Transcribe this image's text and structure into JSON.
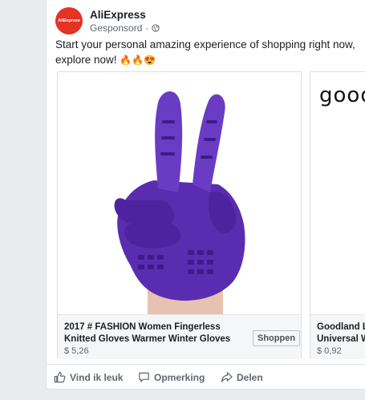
{
  "post": {
    "page_name": "AliExpress",
    "avatar_text": "AliExpress",
    "sponsored_label": "Gesponsord",
    "separator": "·",
    "caption_text": "Start your personal amazing experience of shopping right now, explore now!",
    "caption_emojis": "🔥🔥😍"
  },
  "carousel": {
    "cards": [
      {
        "title": "2017 #  FASHION  Women Fingerless Knitted Gloves Warmer  Winter  Gloves",
        "price": "$ 5,26",
        "button_label": "Shoppen",
        "image_subject": "purple-glove"
      },
      {
        "brand_text": "good",
        "title": "Goodland LE Universal W",
        "price": "$ 0,92"
      }
    ]
  },
  "actions": {
    "like": "Vind ik leuk",
    "comment": "Opmerking",
    "share": "Delen"
  },
  "colors": {
    "brand_red": "#e43225",
    "glove_purple": "#5a2db0",
    "text_secondary": "#606770"
  }
}
